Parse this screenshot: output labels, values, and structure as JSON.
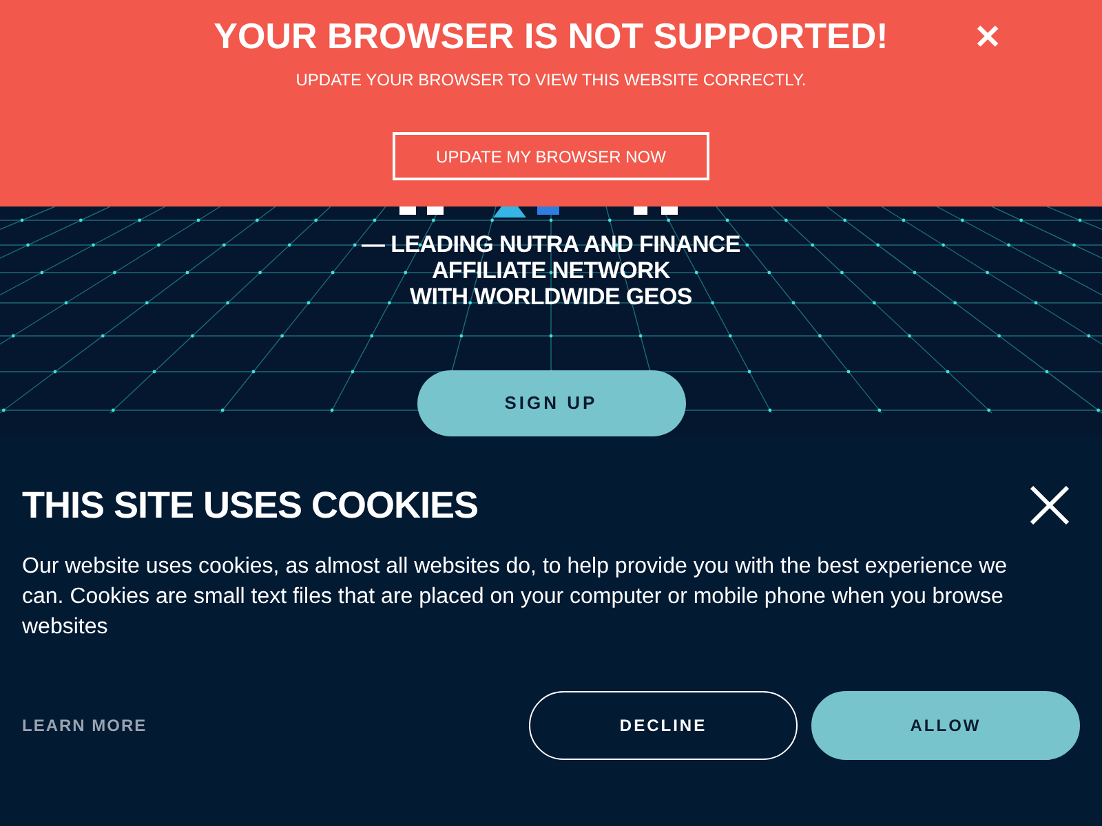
{
  "banner": {
    "title": "YOUR BROWSER IS NOT SUPPORTED!",
    "message": "UPDATE YOUR BROWSER TO VIEW THIS WEBSITE CORRECTLY.",
    "button": "UPDATE MY BROWSER NOW",
    "close": "✕"
  },
  "hero": {
    "tagline": [
      "— LEADING NUTRA AND FINANCE",
      "AFFILIATE NETWORK",
      "WITH WORLDWIDE GEOS"
    ],
    "button": "SIGN UP"
  },
  "cookie_notice": {
    "title": "THIS SITE USES COOKIES",
    "text": "Our website uses cookies, as almost all websites do, to help provide you with the best experience we can. Cookies are small text files that are placed on your computer or mobile phone when you browse websites",
    "link": "LEARN MORE",
    "buttons": [
      {
        "label": "DECLINE",
        "kind": "outline"
      },
      {
        "label": "ALLOW",
        "kind": "filled"
      }
    ]
  }
}
